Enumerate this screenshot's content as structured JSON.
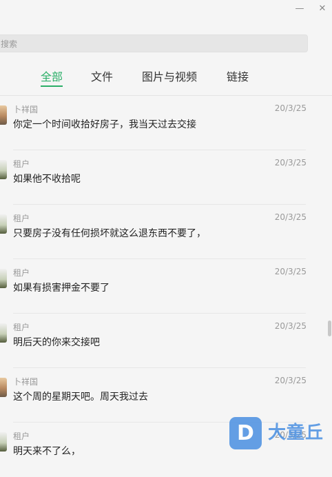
{
  "window": {
    "minimize_icon": "minimize-icon",
    "close_icon": "close-icon"
  },
  "search": {
    "placeholder": "搜索"
  },
  "tabs": [
    {
      "label": "全部",
      "active": true
    },
    {
      "label": "文件",
      "active": false
    },
    {
      "label": "图片与视频",
      "active": false
    },
    {
      "label": "链接",
      "active": false
    }
  ],
  "messages": [
    {
      "sender": "卜祥国",
      "date": "20/3/25",
      "text": "你定一个时间收拾好房子，我当天过去交接",
      "avatar": "a1"
    },
    {
      "sender": "租户",
      "date": "20/3/25",
      "text": "如果他不收拾呢",
      "avatar": "a2"
    },
    {
      "sender": "租户",
      "date": "20/3/25",
      "text": "只要房子没有任何损坏就这么退东西不要了，",
      "avatar": "a2"
    },
    {
      "sender": "租户",
      "date": "20/3/25",
      "text": "如果有损害押金不要了",
      "avatar": "a2"
    },
    {
      "sender": "租户",
      "date": "20/3/25",
      "text": "明后天的你来交接吧",
      "avatar": "a2"
    },
    {
      "sender": "卜祥国",
      "date": "20/3/25",
      "text": "这个周的星期天吧。周天我过去",
      "avatar": "a1"
    },
    {
      "sender": "租户",
      "date": "20/3/25",
      "text": "明天来不了么，",
      "avatar": "a2"
    }
  ],
  "watermark": {
    "logo_letter": "D",
    "brand": "大童丘"
  },
  "colors": {
    "accent": "#2aae67"
  }
}
